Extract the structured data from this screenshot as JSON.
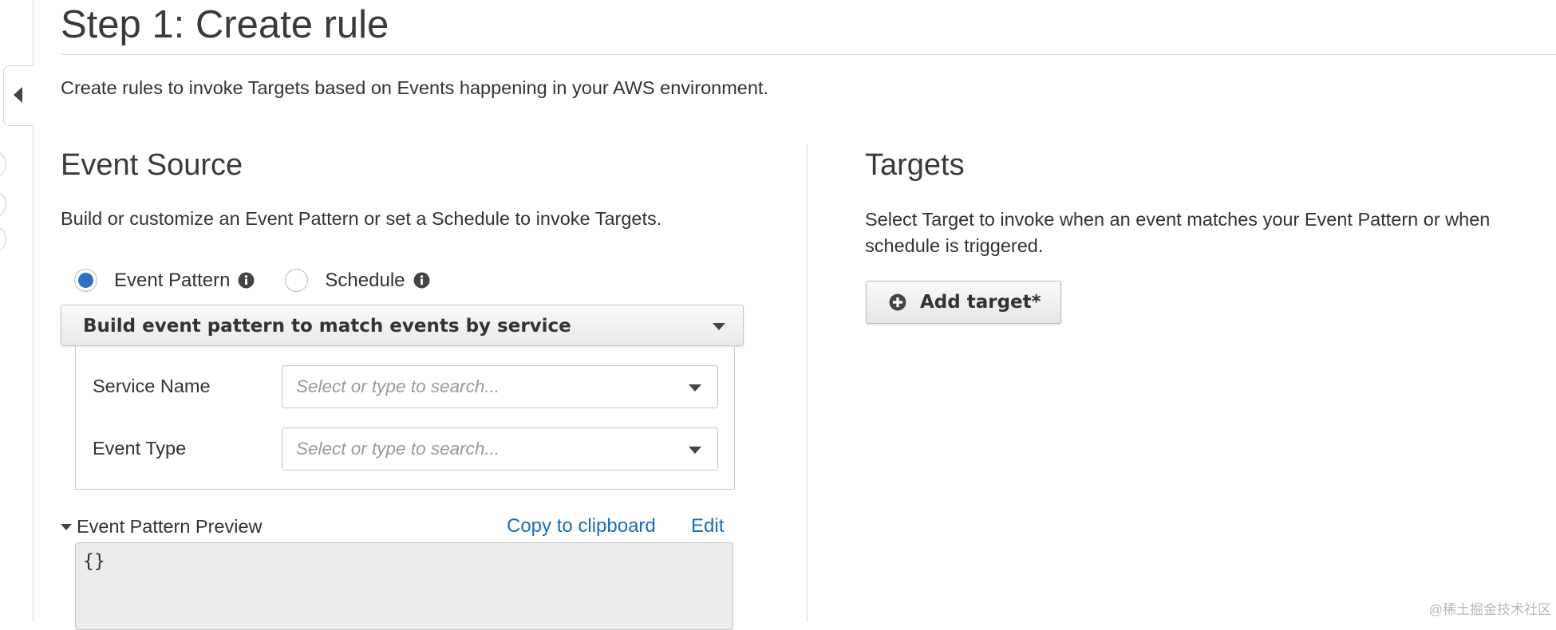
{
  "page": {
    "title": "Step 1: Create rule",
    "description": "Create rules to invoke Targets based on Events happening in your AWS environment."
  },
  "event_source": {
    "title": "Event Source",
    "description": "Build or customize an Event Pattern or set a Schedule to invoke Targets.",
    "radio_event_pattern": "Event Pattern",
    "radio_schedule": "Schedule",
    "selected": "Event Pattern",
    "pattern_select": "Build event pattern to match events by service",
    "service_name_label": "Service Name",
    "service_name_placeholder": "Select or type to search...",
    "event_type_label": "Event Type",
    "event_type_placeholder": "Select or type to search...",
    "preview_label": "Event Pattern Preview",
    "copy_link": "Copy to clipboard",
    "edit_link": "Edit",
    "preview_content": "{}"
  },
  "targets": {
    "title": "Targets",
    "description": "Select Target to invoke when an event matches your Event Pattern or when schedule is triggered.",
    "add_button": "Add target*"
  },
  "watermark": "@稀土掘金技术社区",
  "colors": {
    "accent": "#2e6fbf",
    "link": "#1e6db4"
  },
  "icons": [
    "collapse-arrow-icon",
    "info-icon",
    "chevron-down-icon",
    "plus-circle-icon"
  ]
}
